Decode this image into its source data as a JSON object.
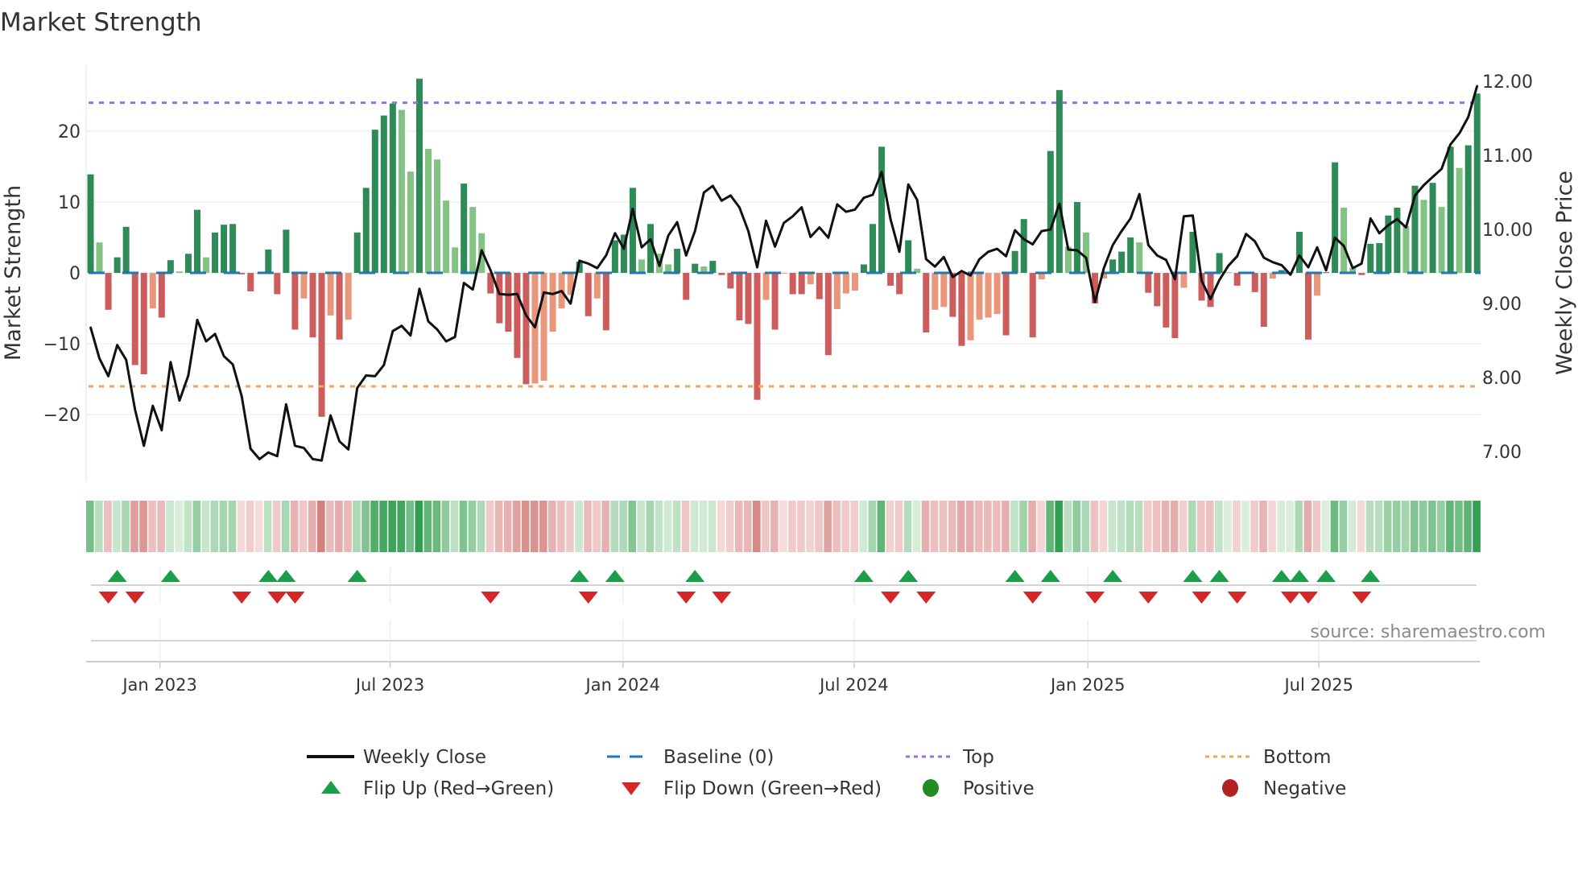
{
  "title": "Market Strength",
  "source": "source: sharemaestro.com",
  "colors": {
    "pos_strong": "#2e8b57",
    "pos_weak": "#82c282",
    "neg_strong": "#cd5c5c",
    "neg_weak": "#e9967a",
    "top": "#9b6fdc",
    "bottom": "#f4a460",
    "baseline": "#1f77b4",
    "flip_up": "#1a9e4a",
    "flip_down": "#d62728",
    "positive": "#228b22",
    "negative": "#b22222",
    "close": "#111111"
  },
  "legend": {
    "weekly_close": "Weekly Close",
    "baseline": "Baseline (0)",
    "top": "Top",
    "bottom": "Bottom",
    "flip_up": "Flip Up (Red→Green)",
    "flip_down": "Flip Down (Green→Red)",
    "positive": "Positive",
    "negative": "Negative"
  },
  "chart_data": {
    "type": "bar+line",
    "title": "Market Strength",
    "ylabel": "Market Strength",
    "y2label": "Weekly Close Price",
    "ylim": [
      -29.4,
      29.3
    ],
    "y2lim": [
      6.6,
      12.22
    ],
    "yticks": [
      {
        "v": 20,
        "label": "20"
      },
      {
        "v": 10,
        "label": "10"
      },
      {
        "v": 0,
        "label": "0"
      },
      {
        "v": -10,
        "label": "−10"
      },
      {
        "v": -20,
        "label": "−20"
      }
    ],
    "y2ticks": [
      {
        "v": 12,
        "label": "12.00"
      },
      {
        "v": 11,
        "label": "11.00"
      },
      {
        "v": 10,
        "label": "10.00"
      },
      {
        "v": 9,
        "label": "9.00"
      },
      {
        "v": 8,
        "label": "8.00"
      },
      {
        "v": 7,
        "label": "7.00"
      }
    ],
    "xticks": [
      {
        "week": 8.8,
        "label": "Jan 2023"
      },
      {
        "week": 34.7,
        "label": "Jul 2023"
      },
      {
        "week": 60.9,
        "label": "Jan 2024"
      },
      {
        "week": 86.9,
        "label": "Jul 2024"
      },
      {
        "week": 113.2,
        "label": "Jan 2025"
      },
      {
        "week": 139.2,
        "label": "Jul 2025"
      }
    ],
    "top": 24,
    "bottom": -16,
    "baseline": 0,
    "strength": [
      13.9,
      4.3,
      -5.2,
      2.2,
      6.5,
      -13,
      -14.3,
      -5,
      -6.3,
      1.8,
      0.2,
      2.7,
      8.9,
      2.2,
      5.7,
      6.8,
      6.9,
      -0.2,
      -2.6,
      -0.1,
      3.3,
      -3,
      6.1,
      -8,
      -3.6,
      -9.1,
      -20.3,
      -6,
      -9.4,
      -6.6,
      5.7,
      12,
      20.2,
      22.2,
      23.9,
      23,
      14.3,
      27.4,
      17.5,
      16,
      10.2,
      3.6,
      12.6,
      9.3,
      5.6,
      -2.9,
      -7.1,
      -8.3,
      -12,
      -15.7,
      -15.6,
      -15.2,
      -8.3,
      -5,
      -3.1,
      1.6,
      -6.1,
      -3.6,
      -8.1,
      4.6,
      5.4,
      12,
      1.9,
      6.9,
      2.7,
      1.2,
      3.4,
      -3.8,
      1.3,
      0.9,
      1.7,
      -0.3,
      -2.2,
      -6.7,
      -7.2,
      -17.9,
      -3.8,
      -8,
      -0.1,
      -3,
      -3,
      -1.6,
      -3.7,
      -11.6,
      -5.1,
      -2.9,
      -2.5,
      1.2,
      6.9,
      17.8,
      -1.8,
      -3,
      4.6,
      0.6,
      -8.4,
      -5.2,
      -4.8,
      -6.2,
      -10.3,
      -9.5,
      -6.6,
      -6.3,
      -5.8,
      -8.8,
      3.1,
      7.6,
      -9.1,
      -0.9,
      17.2,
      25.8,
      3.7,
      10,
      5.7,
      -4.3,
      -0.8,
      1.9,
      3,
      5,
      4.3,
      -2.8,
      -4.7,
      -7.7,
      -9.2,
      -2.1,
      5.8,
      -3.9,
      -4.8,
      2.8,
      0.1,
      -1.8,
      0.1,
      -2.7,
      -7.6,
      -0.8,
      0.4,
      0.1,
      5.8,
      -9.4,
      -3.2,
      0.1,
      15.6,
      9.2,
      0.7,
      -0.3,
      4.1,
      4.2,
      8.1,
      9.2,
      6.6,
      12.3,
      10.3,
      12.7,
      9.3,
      17.8,
      14.8,
      18,
      25.3
    ],
    "close": [
      8.68,
      8.26,
      8.02,
      8.44,
      8.24,
      7.57,
      7.08,
      7.62,
      7.29,
      8.21,
      7.69,
      8.03,
      8.78,
      8.49,
      8.59,
      8.29,
      8.18,
      7.75,
      7.04,
      6.9,
      6.99,
      6.94,
      7.64,
      7.08,
      7.05,
      6.9,
      6.88,
      7.49,
      7.14,
      7.03,
      7.86,
      8.03,
      8.02,
      8.17,
      8.63,
      8.7,
      8.57,
      9.2,
      8.76,
      8.65,
      8.49,
      8.55,
      9.28,
      9.19,
      9.72,
      9.45,
      9.13,
      9.12,
      9.13,
      8.84,
      8.68,
      9.15,
      9.13,
      9.17,
      9.0,
      9.58,
      9.54,
      9.48,
      9.65,
      9.95,
      9.74,
      10.28,
      9.76,
      9.87,
      9.51,
      9.92,
      10.1,
      9.65,
      9.98,
      10.5,
      10.59,
      10.39,
      10.46,
      10.3,
      9.98,
      9.49,
      10.12,
      9.77,
      10.09,
      10.18,
      10.3,
      9.9,
      10.03,
      9.89,
      10.34,
      10.24,
      10.27,
      10.43,
      10.47,
      10.78,
      10.14,
      9.7,
      10.61,
      10.4,
      9.6,
      9.5,
      9.63,
      9.36,
      9.44,
      9.38,
      9.6,
      9.7,
      9.74,
      9.64,
      9.99,
      9.87,
      9.8,
      9.98,
      10.0,
      10.35,
      9.73,
      9.72,
      9.62,
      9.02,
      9.48,
      9.79,
      9.98,
      10.15,
      10.48,
      9.79,
      9.65,
      9.59,
      9.33,
      10.18,
      10.19,
      9.31,
      9.06,
      9.32,
      9.51,
      9.64,
      9.94,
      9.84,
      9.62,
      9.56,
      9.52,
      9.39,
      9.65,
      9.49,
      9.76,
      9.45,
      9.89,
      9.78,
      9.48,
      9.54,
      10.15,
      9.95,
      10.06,
      10.14,
      10.03,
      10.46,
      10.6,
      10.71,
      10.82,
      11.15,
      11.3,
      11.52,
      11.94
    ],
    "flip_up_weeks": [
      4,
      10,
      21,
      23,
      31,
      56,
      60,
      69,
      88,
      93,
      105,
      109,
      116,
      125,
      128,
      135,
      137,
      140,
      145
    ],
    "flip_down_weeks": [
      3,
      6,
      18,
      22,
      24,
      46,
      57,
      68,
      72,
      91,
      95,
      107,
      114,
      120,
      126,
      130,
      136,
      138,
      144
    ],
    "legend_placement": "bottom"
  }
}
